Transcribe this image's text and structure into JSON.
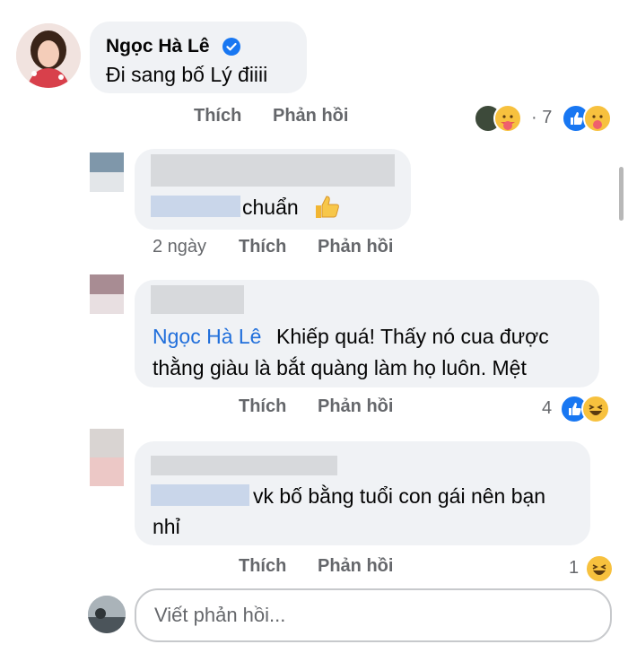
{
  "comment_main": {
    "author": "Ngọc Hà Lê",
    "text": "Đi sang bố Lý điiii",
    "actions": {
      "like": "Thích",
      "reply": "Phản hồi"
    },
    "reaction_count": "· 7"
  },
  "reply_1": {
    "text": "chuẩn",
    "time": "2 ngày",
    "actions": {
      "like": "Thích",
      "reply": "Phản hồi"
    }
  },
  "reply_2": {
    "mention": "Ngọc Hà Lê",
    "text_line1": "Khiếp quá! Thấy nó cua được",
    "text_line2": "thằng giàu là bắt quàng làm họ luôn. Mệt",
    "actions": {
      "like": "Thích",
      "reply": "Phản hồi"
    },
    "reaction_count": "4"
  },
  "reply_3": {
    "text_line1": "vk bố bằng tuổi con gái nên bạn",
    "text_line2": "nhỉ",
    "actions": {
      "like": "Thích",
      "reply": "Phản hồi"
    },
    "reaction_count": "1"
  },
  "composer": {
    "placeholder": "Viết phản hồi..."
  },
  "colors": {
    "accent_blue": "#1877f2",
    "mention_blue": "#216fdb",
    "bubble_bg": "#f0f2f5",
    "secondary_text": "#65676b"
  }
}
